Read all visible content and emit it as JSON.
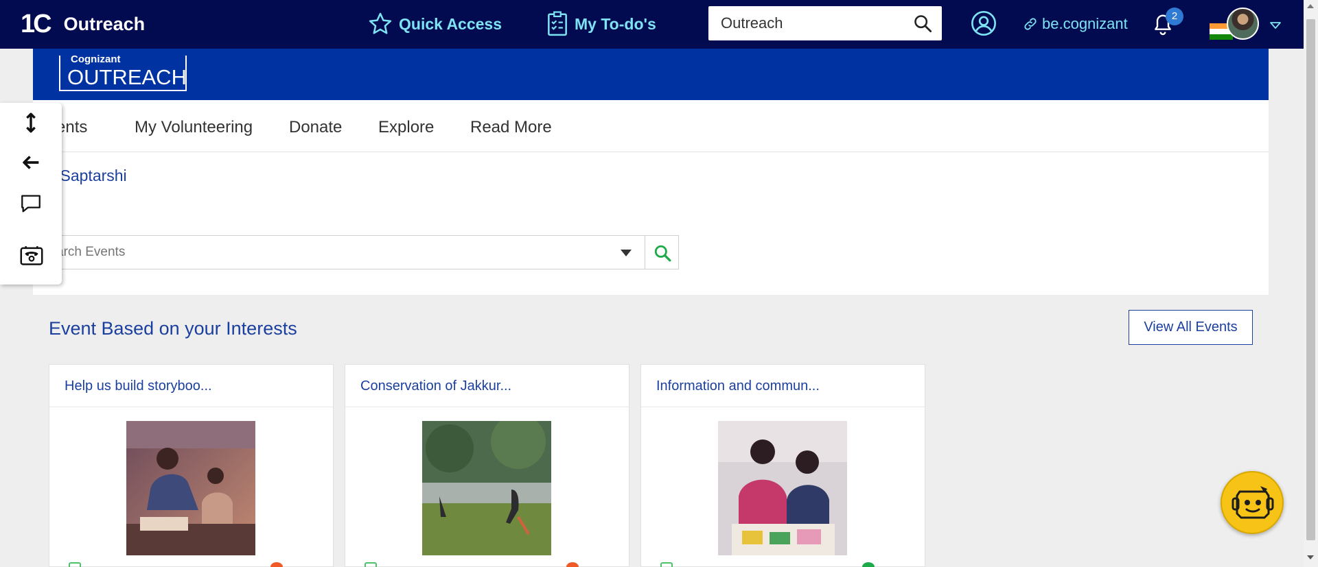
{
  "topbar": {
    "brand_logo": "1C",
    "brand_name": "Outreach",
    "quick_access": "Quick Access",
    "todos": "My To-do's",
    "search_value": "Outreach",
    "be_link": "be.cognizant",
    "notification_count": "2"
  },
  "banner": {
    "logo_top": "Cognizant",
    "logo_main": "OUTREACH"
  },
  "nav": {
    "items": [
      "vents",
      "My Volunteering",
      "Donate",
      "Explore",
      "Read More"
    ]
  },
  "greeting": "i Saptarshi",
  "event_search": {
    "placeholder": "arch Events"
  },
  "section": {
    "title": "Event Based on your Interests",
    "view_all": "View All Events"
  },
  "cards": [
    {
      "title": "Help us build storyboo..."
    },
    {
      "title": "Conservation of Jakkur..."
    },
    {
      "title": "Information and commun..."
    }
  ],
  "colors": {
    "topbar_bg": "#020b4f",
    "accent_cyan": "#7ee3f4",
    "banner_blue": "#0033a1",
    "link_blue": "#1b3f9e",
    "chatbot_yellow": "#f6c316"
  },
  "icons": {
    "quick_access": "star-icon",
    "todos": "checklist-icon",
    "search": "search-icon",
    "profile": "user-search-icon",
    "link": "link-icon",
    "notifications": "bell-icon",
    "side_tools": [
      "expand-vertical-icon",
      "arrow-left-icon",
      "chat-bubble-icon",
      "support-phone-icon"
    ],
    "chatbot": "chatbot-icon"
  }
}
